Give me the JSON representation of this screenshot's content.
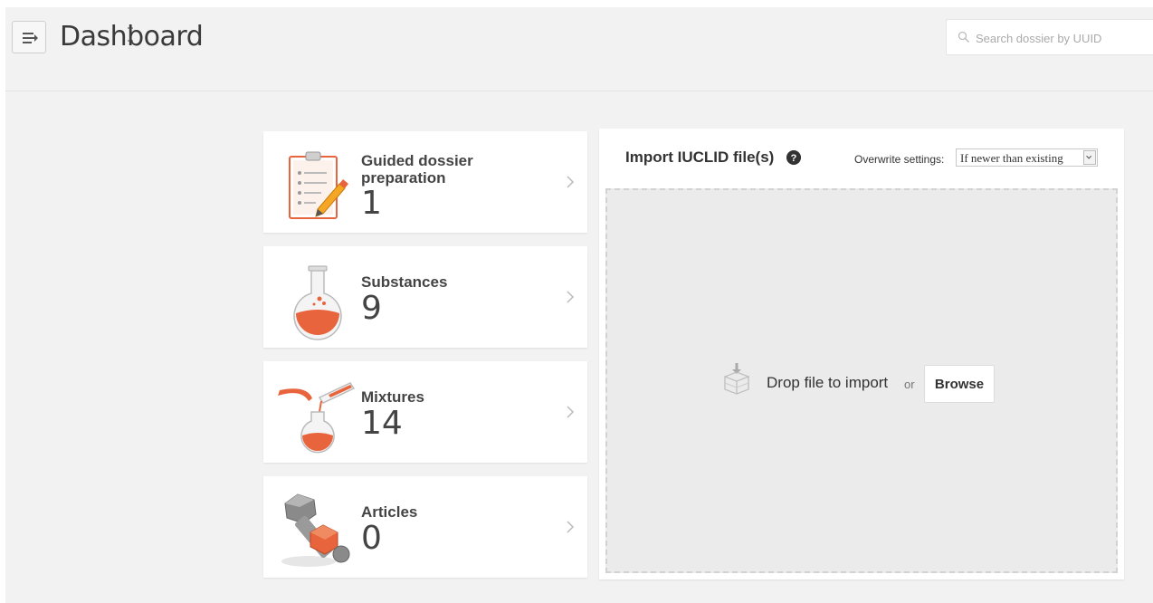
{
  "header": {
    "title": "Dashboard",
    "search_placeholder": "Search dossier by UUID"
  },
  "cards": [
    {
      "label": "Guided dossier preparation",
      "count": "1",
      "icon": "clipboard-pencil-icon"
    },
    {
      "label": "Substances",
      "count": "9",
      "icon": "flask-icon"
    },
    {
      "label": "Mixtures",
      "count": "14",
      "icon": "pouring-flask-icon"
    },
    {
      "label": "Articles",
      "count": "0",
      "icon": "bolt-nut-icon"
    }
  ],
  "import": {
    "title": "Import IUCLID file(s)",
    "overwrite_label": "Overwrite settings:",
    "overwrite_value": "If newer than existing",
    "drop_text": "Drop file to import",
    "or_text": "or",
    "browse_label": "Browse"
  },
  "colors": {
    "accent": "#e8643c",
    "background": "#f2f2f2",
    "panel": "#ffffff",
    "dropzone": "#ebebeb"
  }
}
